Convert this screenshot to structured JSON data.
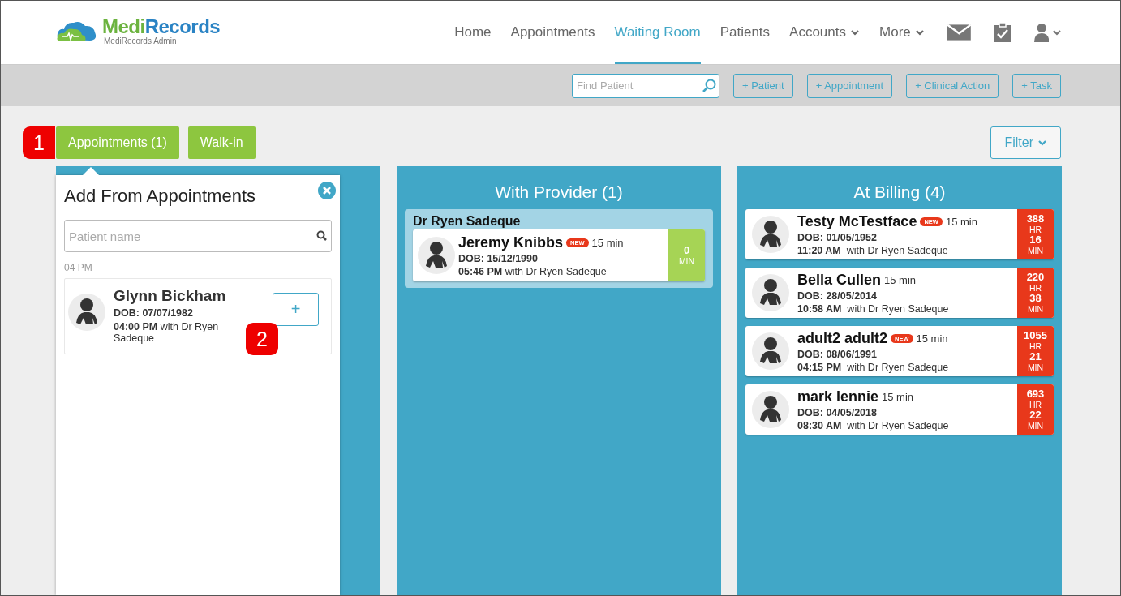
{
  "header": {
    "logo": {
      "brand_part_1": "Medi",
      "brand_part_2": "Records",
      "subtitle": "MediRecords Admin"
    },
    "nav": [
      {
        "label": "Home",
        "selected": false,
        "has_menu": false
      },
      {
        "label": "Appointments",
        "selected": false,
        "has_menu": false
      },
      {
        "label": "Waiting Room",
        "selected": true,
        "has_menu": false
      },
      {
        "label": "Patients",
        "selected": false,
        "has_menu": false
      },
      {
        "label": "Accounts",
        "selected": false,
        "has_menu": true
      },
      {
        "label": "More",
        "selected": false,
        "has_menu": true
      }
    ],
    "icon_buttons": [
      {
        "kind": "mail",
        "has_menu": false
      },
      {
        "kind": "tasks",
        "has_menu": false
      },
      {
        "kind": "user",
        "has_menu": true
      }
    ]
  },
  "toolbar": {
    "search": {
      "placeholder": "Find Patient"
    },
    "buttons": [
      "+ Patient",
      "+ Appointment",
      "+ Clinical Action",
      "+ Task"
    ]
  },
  "view_tabs": [
    {
      "label": "Appointments (1)",
      "callout": "1"
    },
    {
      "label": "Walk-in"
    }
  ],
  "filter": {
    "label": "Filter"
  },
  "columns": [
    {
      "popup": {
        "title": "Add From Appointments",
        "search": {
          "placeholder": "Patient name"
        },
        "sections": [
          {
            "time": "04 PM",
            "appointments": [
              {
                "name": "Glynn Bickham",
                "dob": "DOB: 07/07/1982",
                "time_line": "**04:00 PM** with Dr Ryen Sadeque",
                "add_button": "+",
                "callout": "2"
              }
            ]
          }
        ]
      }
    },
    {
      "title": "With Provider (1)",
      "groups": [
        {
          "provider": "Dr Ryen Sadeque",
          "cards": [
            {
              "name": "Jeremy Knibbs",
              "badge": "NEW",
              "duration": "15 min",
              "dob": "DOB: 15/12/1990",
              "time_line": "**05:46 PM** with Dr Ryen Sadeque",
              "timer": {
                "color": "#a6d455",
                "parts": [
                  {
                    "value": "0",
                    "unit": "MIN"
                  }
                ]
              }
            }
          ]
        }
      ]
    },
    {
      "title": "At Billing (4)",
      "cards": [
        {
          "name": "Testy McTestface",
          "badge": "NEW",
          "duration": "15 min",
          "dob": "DOB: 01/05/1952",
          "time_line": "**11:20 AM**  with Dr Ryen Sadeque",
          "timer": {
            "color": "#e8381b",
            "parts": [
              {
                "value": "388",
                "unit": "HR"
              },
              {
                "value": "16",
                "unit": "MIN"
              }
            ]
          }
        },
        {
          "name": "Bella Cullen",
          "duration": "15 min",
          "dob": "DOB: 28/05/2014",
          "time_line": "**10:58 AM**  with Dr Ryen Sadeque",
          "timer": {
            "color": "#e8381b",
            "parts": [
              {
                "value": "220",
                "unit": "HR"
              },
              {
                "value": "38",
                "unit": "MIN"
              }
            ]
          }
        },
        {
          "name": "adult2 adult2",
          "badge": "NEW",
          "duration": "15 min",
          "dob": "DOB: 08/06/1991",
          "time_line": "**04:15 PM**  with Dr Ryen Sadeque",
          "timer": {
            "color": "#e8381b",
            "parts": [
              {
                "value": "1055",
                "unit": "HR"
              },
              {
                "value": "21",
                "unit": "MIN"
              }
            ]
          }
        },
        {
          "name": "mark lennie",
          "duration": "15 min",
          "dob": "DOB: 04/05/2018",
          "time_line": "**08:30 AM**  with Dr Ryen Sadeque",
          "timer": {
            "color": "#e8381b",
            "parts": [
              {
                "value": "693",
                "unit": "HR"
              },
              {
                "value": "22",
                "unit": "MIN"
              }
            ]
          }
        }
      ]
    }
  ]
}
